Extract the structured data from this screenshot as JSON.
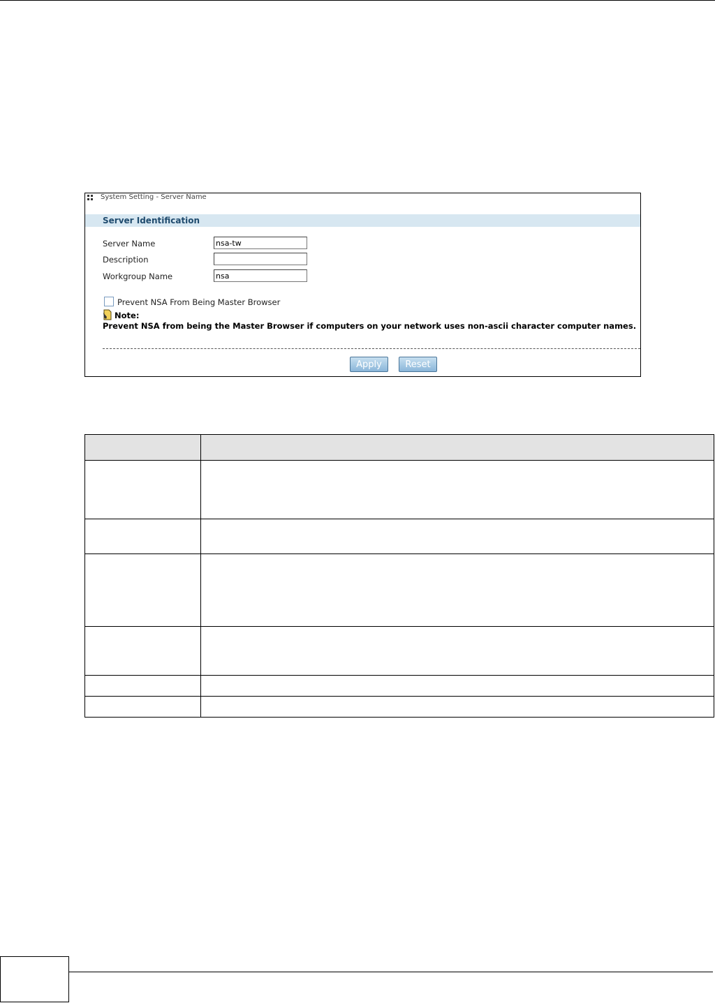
{
  "panel": {
    "title": "System Setting - Server Name",
    "section_title": "Server Identification",
    "fields": [
      {
        "label": "Server Name",
        "value": "nsa-tw"
      },
      {
        "label": "Description",
        "value": ""
      },
      {
        "label": "Workgroup Name",
        "value": "nsa"
      }
    ],
    "checkbox_label": "Prevent NSA From Being Master Browser",
    "checkbox_checked": false,
    "note_label": "Note:",
    "note_text": "Prevent NSA from being the Master Browser if computers on your network uses non-ascii character computer names.",
    "apply_label": "Apply",
    "reset_label": "Reset"
  },
  "table": {
    "header": [
      "",
      ""
    ],
    "rows": [
      [
        "",
        ""
      ],
      [
        "",
        ""
      ],
      [
        "",
        ""
      ],
      [
        "",
        ""
      ],
      [
        "",
        ""
      ],
      [
        "",
        ""
      ]
    ]
  }
}
